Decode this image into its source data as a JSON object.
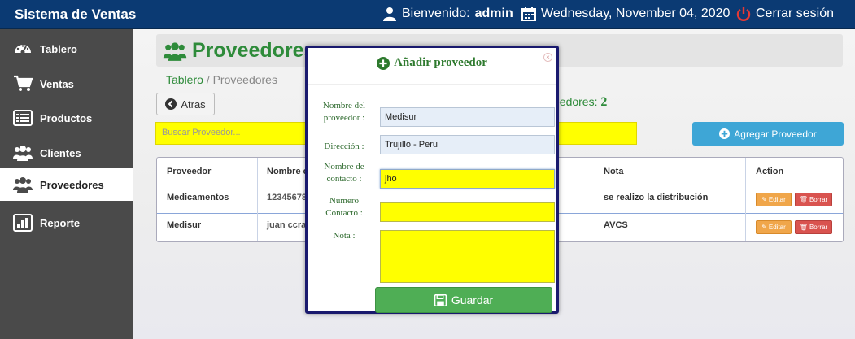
{
  "app": {
    "title": "Sistema de Ventas"
  },
  "header": {
    "welcome_label": "Bienvenido:",
    "user": "admin",
    "date": "Wednesday, November 04, 2020",
    "logout": "Cerrar sesión"
  },
  "sidebar": {
    "items": [
      {
        "label": "Tablero",
        "icon": "dashboard-icon"
      },
      {
        "label": "Ventas",
        "icon": "cart-icon"
      },
      {
        "label": "Productos",
        "icon": "list-icon"
      },
      {
        "label": "Clientes",
        "icon": "users-icon"
      },
      {
        "label": "Proveedores",
        "icon": "users-icon",
        "active": true
      },
      {
        "label": "Reporte",
        "icon": "bar-chart-icon"
      }
    ]
  },
  "page": {
    "title": "Proveedores",
    "breadcrumb_root": "Tablero",
    "breadcrumb_sep": "/",
    "breadcrumb_current": "Proveedores",
    "back_label": "Atras",
    "count_label": "eedores:",
    "count_value": "2",
    "search_placeholder": "Buscar Proveedor...",
    "add_label": "Agregar Proveedor"
  },
  "table": {
    "headers": [
      "Proveedor",
      "Nombre c",
      "Nota",
      "Action"
    ],
    "rows": [
      {
        "proveedor": "Medicamentos",
        "nombre": "12345678",
        "nota": "se realizo la distribución"
      },
      {
        "proveedor": "Medisur",
        "nombre": "juan ccra",
        "nota": "AVCS"
      }
    ],
    "edit_label": "Editar",
    "delete_label": "Borrar"
  },
  "modal": {
    "title": "Añadir proveedor",
    "close": "×",
    "fields": {
      "nombre_label_1": "Nombre del",
      "nombre_label_2": "proveedor :",
      "nombre_value": "Medisur",
      "direccion_label": "Dirección :",
      "direccion_value": "Trujillo - Peru",
      "contacto_label_1": "Nombre de",
      "contacto_label_2": "contacto :",
      "contacto_value": "jho",
      "numero_label_1": "Numero",
      "numero_label_2": "Contacto :",
      "numero_value": "",
      "nota_label": "Nota :",
      "nota_value": ""
    },
    "save_label": "Guardar"
  },
  "colors": {
    "header_bg": "#0b3a73",
    "sidebar_bg": "#4a4a4a",
    "accent_green": "#2e8b3a",
    "highlight_yellow": "#ffff00",
    "add_button": "#3ea6d6",
    "save_button": "#4fae55",
    "logout_icon": "#e53935"
  }
}
